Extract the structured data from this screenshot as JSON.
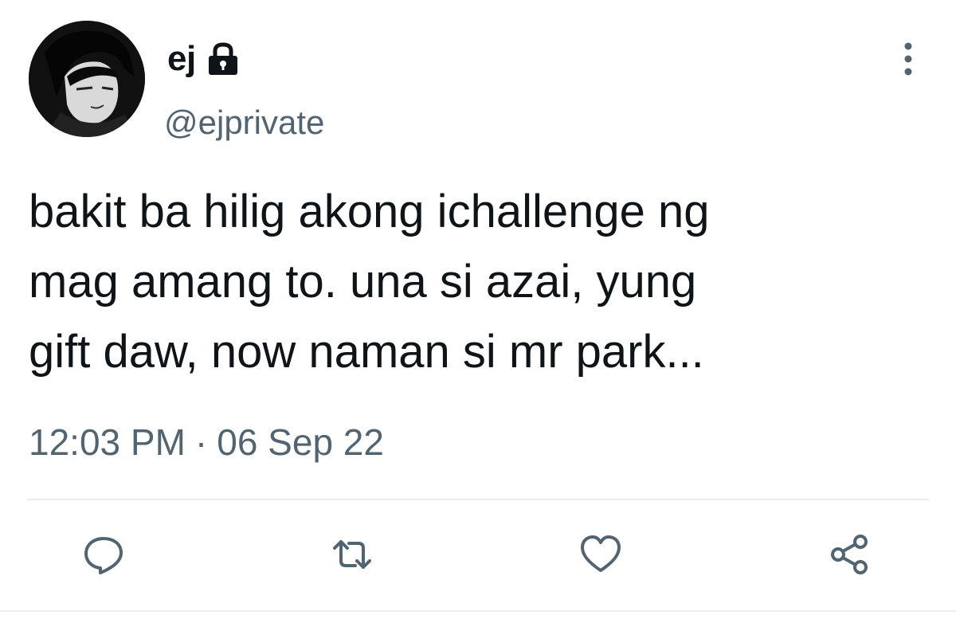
{
  "author": {
    "display_name": "ej",
    "handle": "@ejprivate",
    "protected_icon": "lock-icon",
    "avatar": "avatar-image"
  },
  "tweet": {
    "text": "bakit ba hilig akong ichallenge ng\nmag amang to. una si azai, yung\ngift daw, now naman si mr park...",
    "time": "12:03 PM",
    "separator": "·",
    "date": "06 Sep 22"
  },
  "actions": [
    {
      "icon": "reply-icon"
    },
    {
      "icon": "retweet-icon"
    },
    {
      "icon": "like-icon"
    },
    {
      "icon": "share-icon"
    }
  ],
  "menu": {
    "icon": "more-options-icon"
  },
  "colors": {
    "text_primary": "#0f1419",
    "text_secondary": "#536471",
    "icon_color": "#536471",
    "divider": "#e6ecf0"
  }
}
